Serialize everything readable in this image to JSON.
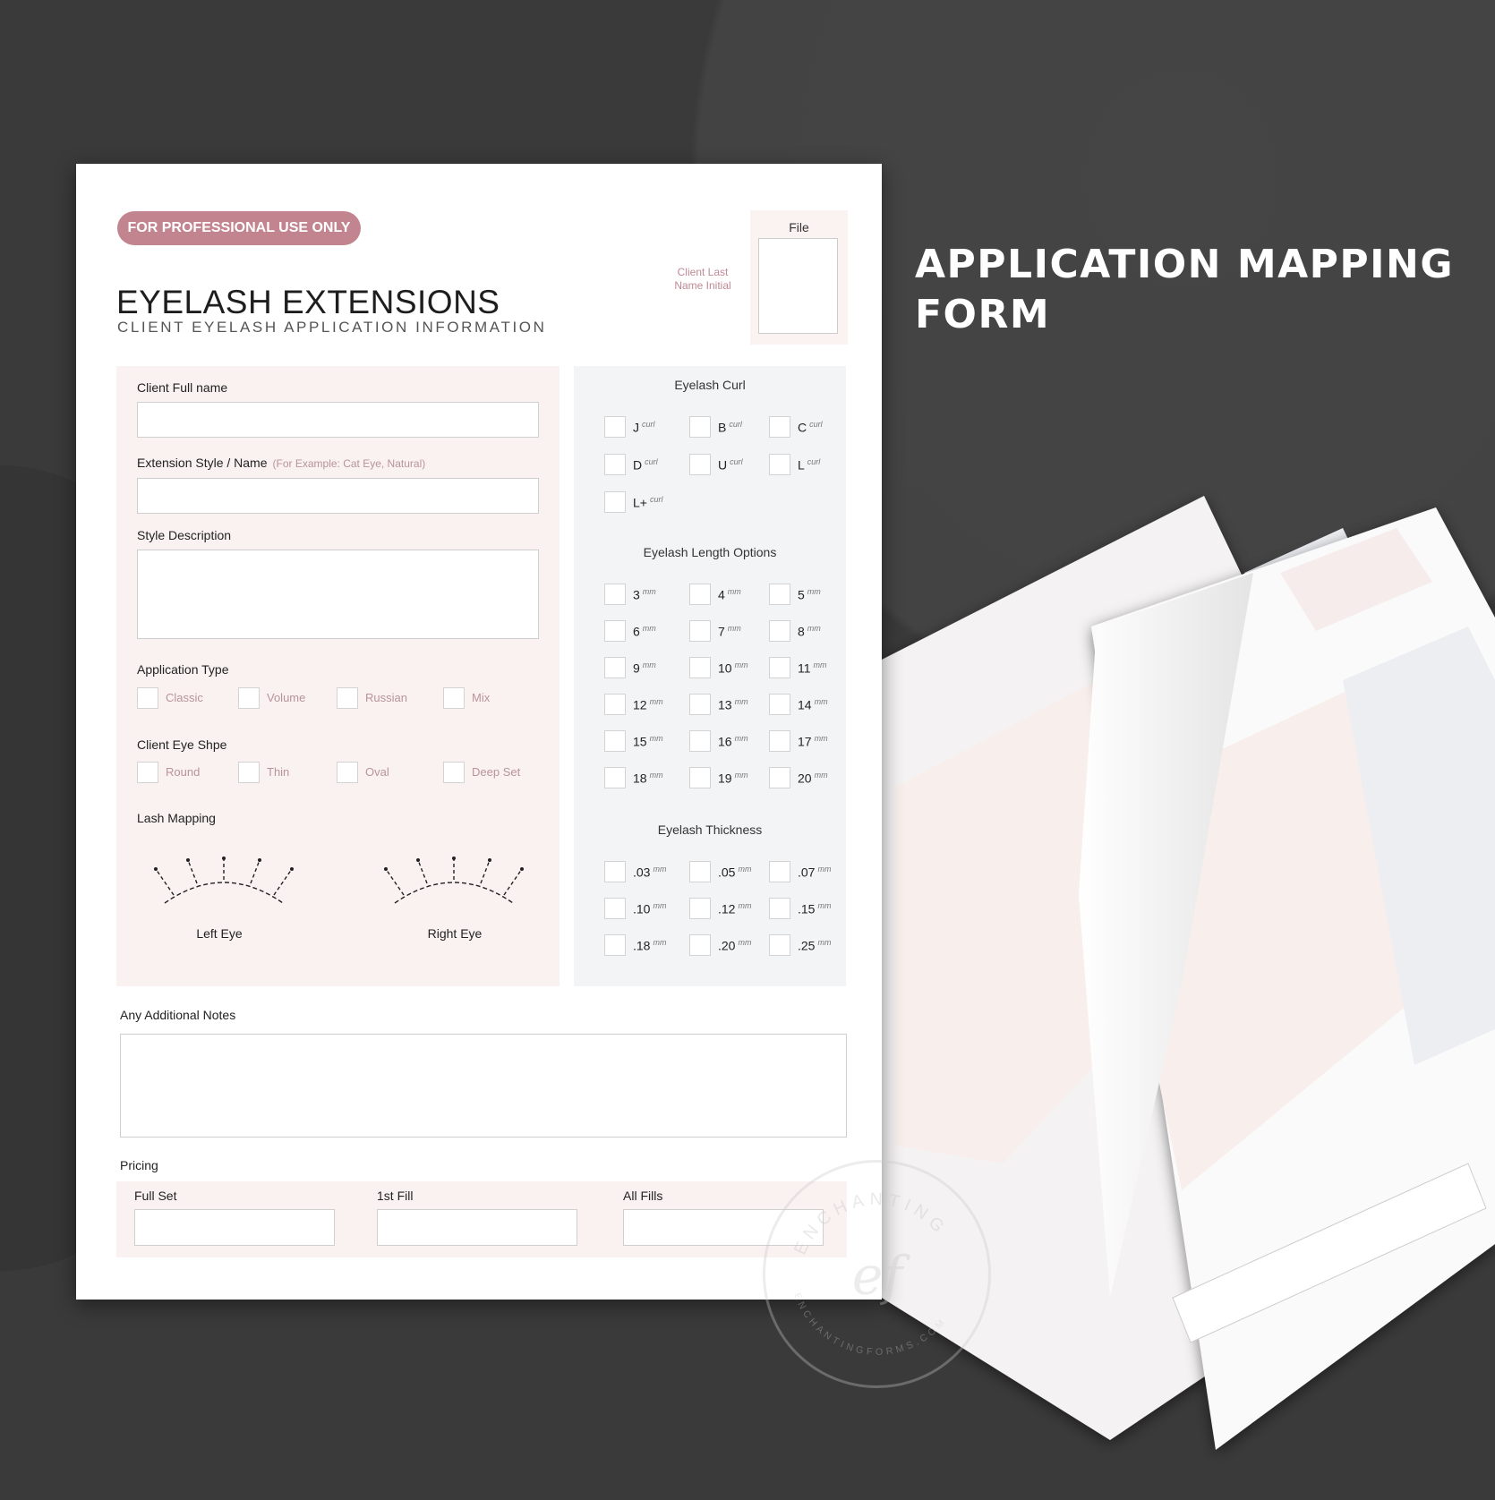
{
  "heading": {
    "line1": "APPLICATION MAPPING",
    "line2": "FORM"
  },
  "form": {
    "badge": "FOR PROFESSIONAL USE ONLY",
    "title": "EYELASH EXTENSIONS",
    "subtitle": "CLIENT EYELASH APPLICATION INFORMATION",
    "file_label": "File",
    "initial_label": "Client Last Name Initial",
    "client_full_name_label": "Client Full name",
    "extension_style_label": "Extension Style / Name",
    "extension_style_hint": "(For Example: Cat Eye, Natural)",
    "style_description_label": "Style Description",
    "application_type": {
      "label": "Application Type",
      "options": [
        "Classic",
        "Volume",
        "Russian",
        "Mix"
      ]
    },
    "eye_shape": {
      "label": "Client Eye Shpe",
      "options": [
        "Round",
        "Thin",
        "Oval",
        "Deep Set"
      ]
    },
    "lash_mapping": {
      "label": "Lash Mapping",
      "left": "Left Eye",
      "right": "Right Eye"
    },
    "curl": {
      "title": "Eyelash Curl",
      "unit": "curl",
      "options": [
        "J",
        "B",
        "C",
        "D",
        "U",
        "L",
        "L+"
      ]
    },
    "length": {
      "title": "Eyelash Length Options",
      "unit": "mm",
      "options": [
        "3",
        "4",
        "5",
        "6",
        "7",
        "8",
        "9",
        "10",
        "11",
        "12",
        "13",
        "14",
        "15",
        "16",
        "17",
        "18",
        "19",
        "20"
      ]
    },
    "thickness": {
      "title": "Eyelash Thickness",
      "unit": "mm",
      "options": [
        ".03",
        ".05",
        ".07",
        ".10",
        ".12",
        ".15",
        ".18",
        ".20",
        ".25"
      ]
    },
    "notes_label": "Any Additional Notes",
    "pricing": {
      "label": "Pricing",
      "fields": [
        "Full Set",
        "1st Fill",
        "All Fills"
      ]
    }
  },
  "watermark": {
    "top": "ENCHANTING",
    "bottom": "ENCHANTINGFORMS.COM",
    "monogram": "ef"
  },
  "colors": {
    "accent": "#c2848f",
    "left_panel": "#f9f2f1",
    "right_panel": "#f3f4f6",
    "background": "#3a3a3a"
  }
}
